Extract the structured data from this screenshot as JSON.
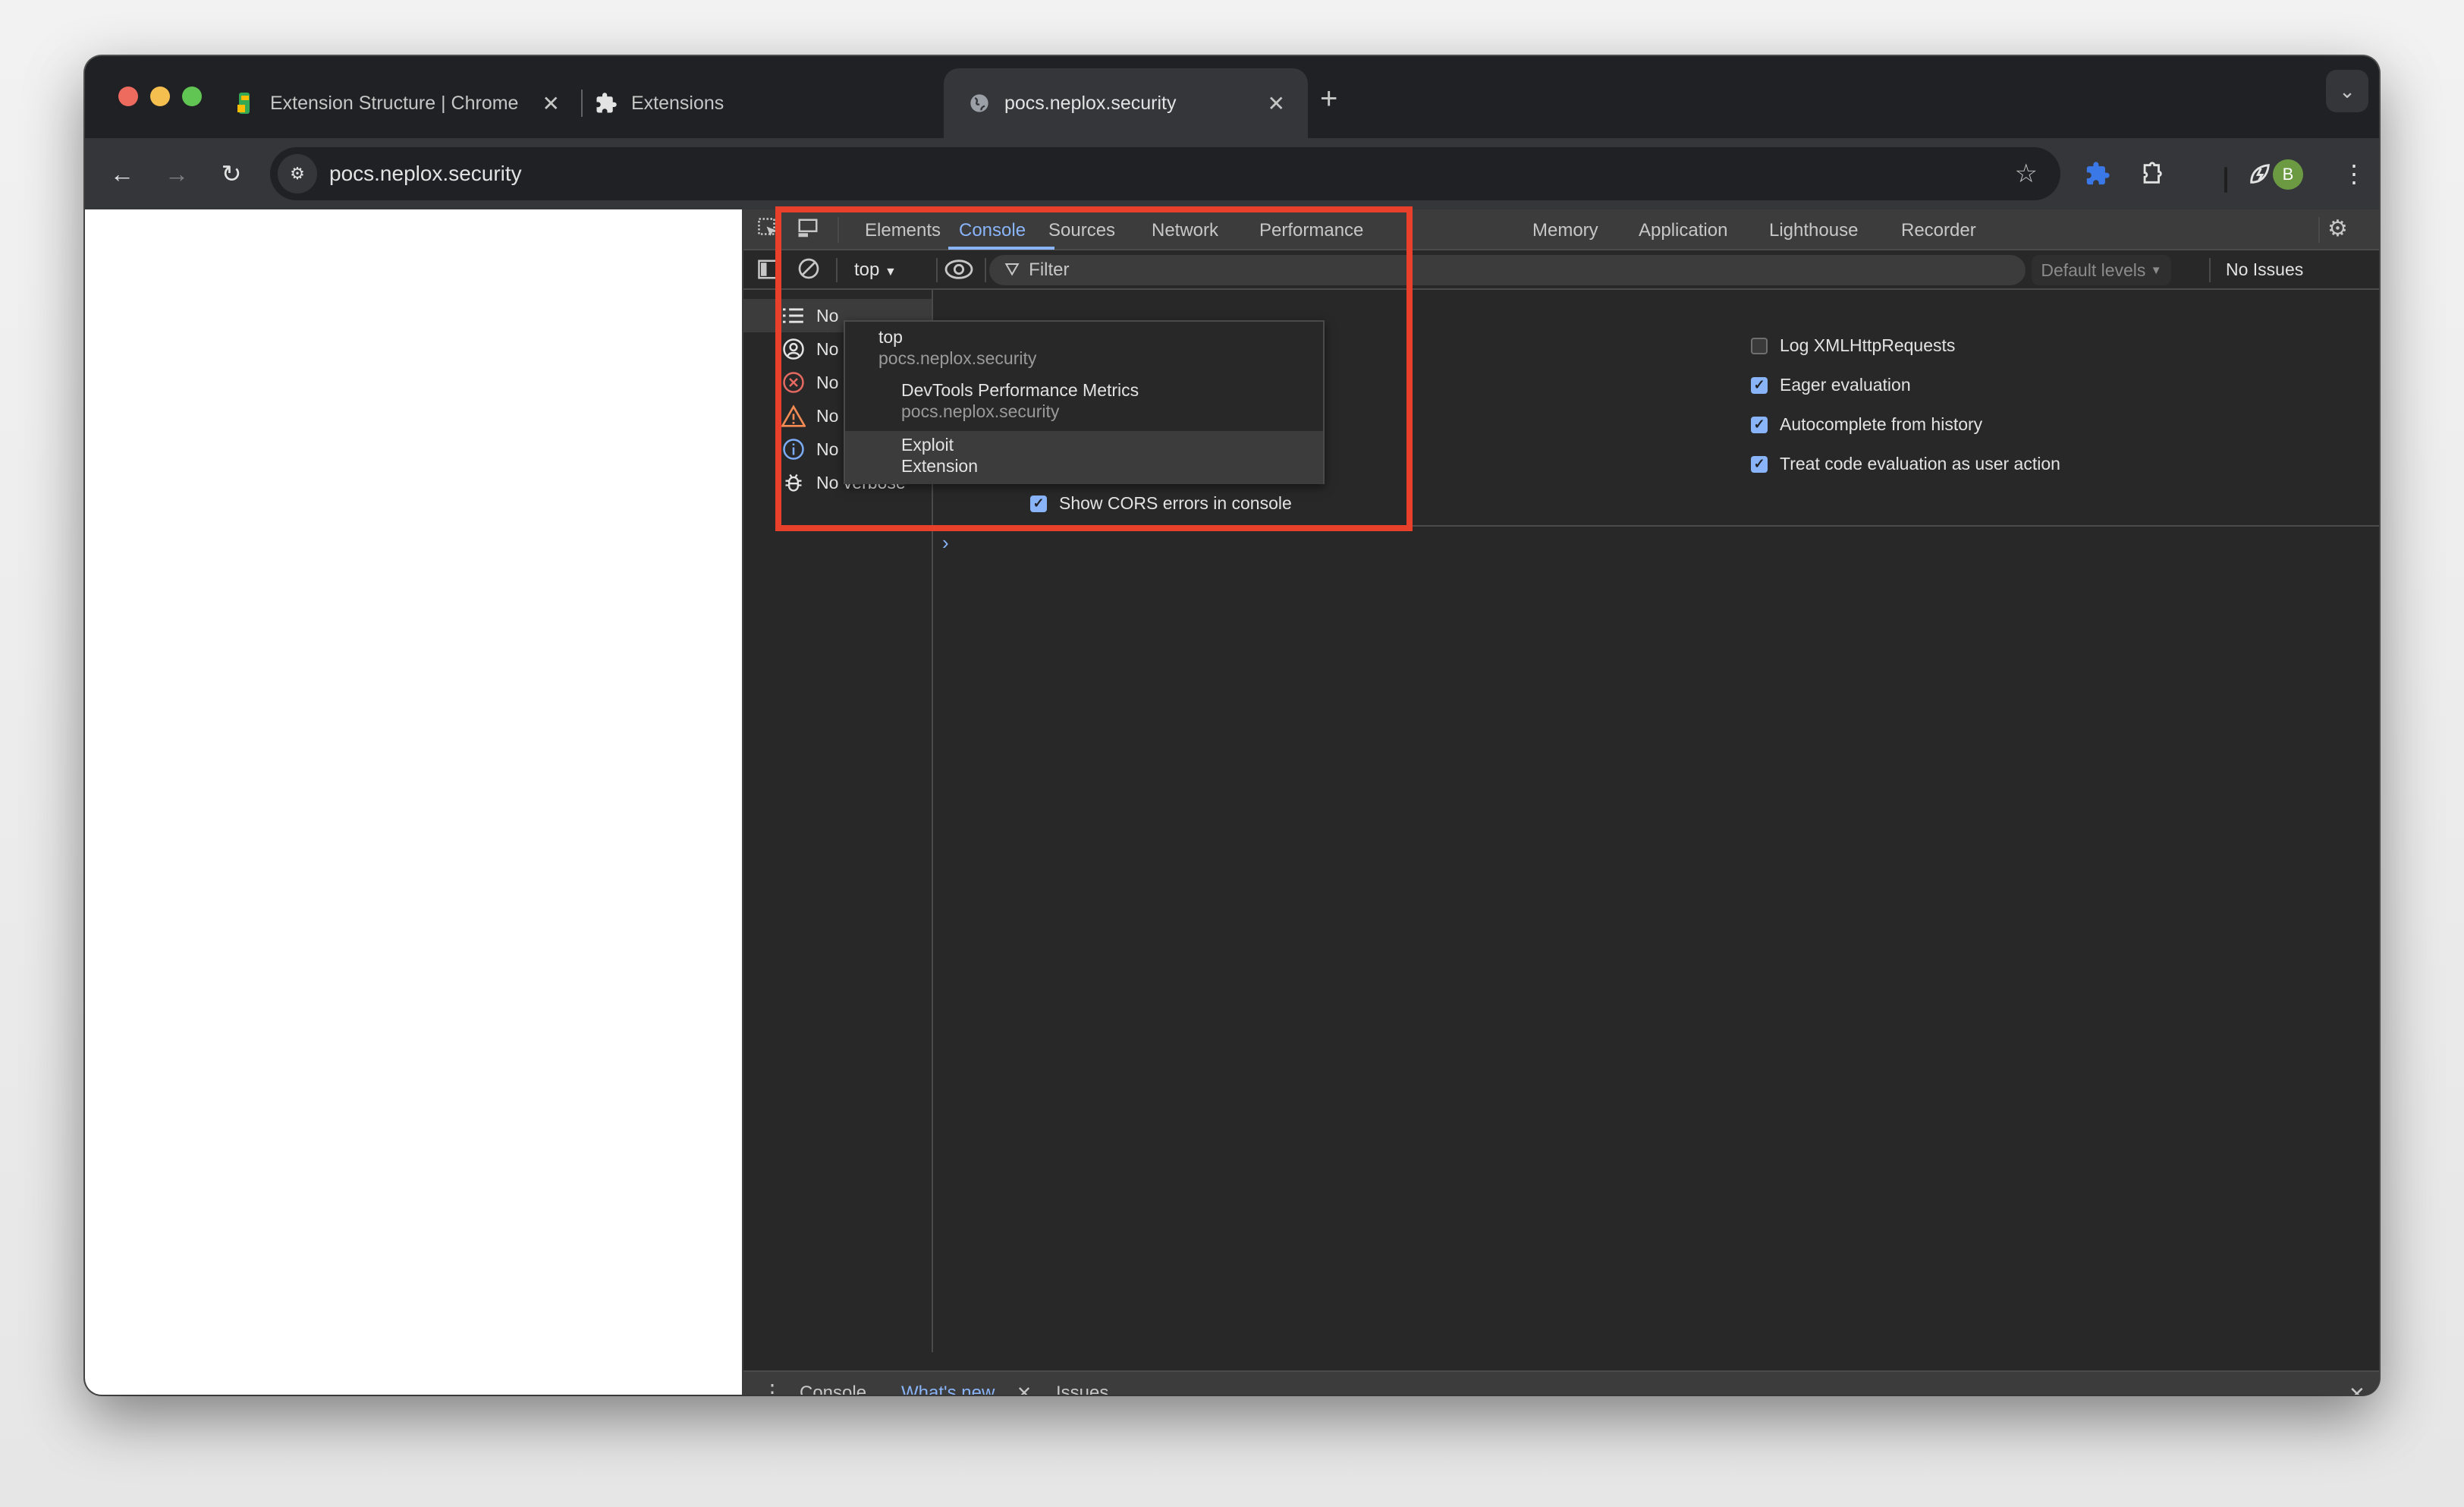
{
  "browser": {
    "tabs": [
      {
        "title": "Extension Structure | Chrome",
        "icon": "chrome-dino-icon",
        "active": false
      },
      {
        "title": "Extensions",
        "icon": "puzzle-icon",
        "active": false
      },
      {
        "title": "pocs.neplox.security",
        "icon": "globe-icon",
        "active": true
      }
    ],
    "new_tab_label": "+",
    "address": "pocs.neplox.security",
    "profile_initial": "B",
    "colors": {
      "accent": "#8ab4f8",
      "profile": "#6b9a43",
      "extension_active": "#3b78e7",
      "highlight_box": "#e8402a"
    }
  },
  "devtools": {
    "tabs": [
      "Elements",
      "Console",
      "Sources",
      "Network",
      "Performance",
      "Memory",
      "Application",
      "Lighthouse",
      "Recorder"
    ],
    "active_tab": "Console",
    "console_toolbar": {
      "context_selector": "top",
      "filter_placeholder": "Filter",
      "levels": "Default levels",
      "issues": "No Issues"
    },
    "sidebar": [
      {
        "label": "No messages",
        "visible": "No",
        "icon": "list-icon"
      },
      {
        "label": "No user messages",
        "visible": "No",
        "icon": "user-icon"
      },
      {
        "label": "No errors",
        "visible": "No",
        "icon": "error-icon"
      },
      {
        "label": "No warnings",
        "visible": "No",
        "icon": "warning-icon"
      },
      {
        "label": "No info",
        "visible": "No info",
        "icon": "info-icon"
      },
      {
        "label": "No verbose",
        "visible": "No verbose",
        "icon": "bug-icon"
      }
    ],
    "settings_left": [
      {
        "label": "Show CORS errors in console",
        "checked": true
      }
    ],
    "settings_right": [
      {
        "label": "Log XMLHttpRequests",
        "checked": false
      },
      {
        "label": "Eager evaluation",
        "checked": true
      },
      {
        "label": "Autocomplete from history",
        "checked": true
      },
      {
        "label": "Treat code evaluation as user action",
        "checked": true
      }
    ],
    "context_dropdown": [
      {
        "title": "top",
        "subtitle": "pocs.neplox.security",
        "indent": false,
        "highlighted": false
      },
      {
        "title": "DevTools Performance Metrics",
        "subtitle": "pocs.neplox.security",
        "indent": true,
        "highlighted": false
      },
      {
        "title": "Exploit",
        "subtitle": "Extension",
        "indent": true,
        "highlighted": true
      }
    ],
    "drawer_tabs": [
      {
        "label": "Console",
        "active": false,
        "closable": false
      },
      {
        "label": "What's new",
        "active": true,
        "closable": true
      },
      {
        "label": "Issues",
        "active": false,
        "closable": false
      }
    ],
    "prompt": "›"
  }
}
